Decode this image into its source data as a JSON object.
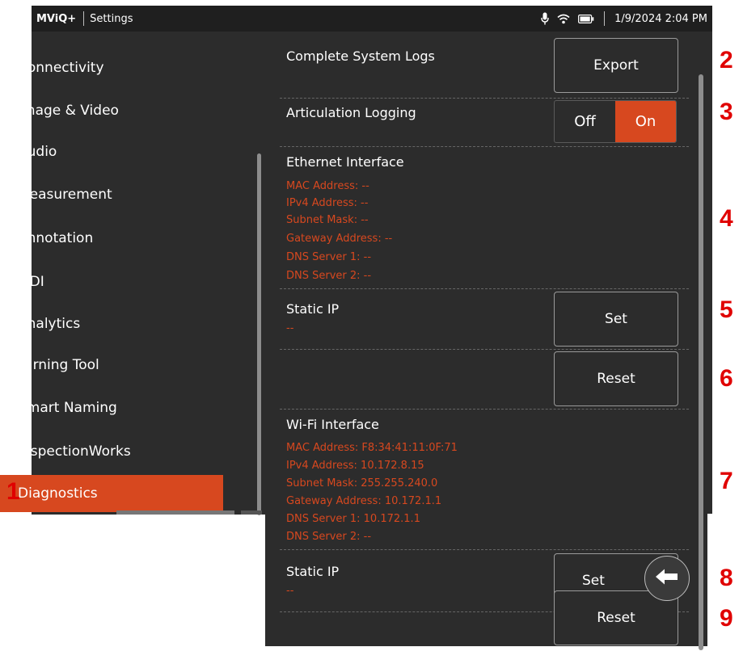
{
  "status_bar": {
    "app_name": "MViQ+",
    "screen_title": "Settings",
    "datetime": "1/9/2024 2:04 PM",
    "icons": [
      "microphone-icon",
      "wifi-icon",
      "battery-icon"
    ]
  },
  "sidebar": {
    "items": [
      {
        "label": "Connectivity"
      },
      {
        "label": "Image & Video"
      },
      {
        "label": "Audio"
      },
      {
        "label": "Measurement"
      },
      {
        "label": "Annotation"
      },
      {
        "label": "MDI"
      },
      {
        "label": "Analytics"
      },
      {
        "label": "Turning Tool"
      },
      {
        "label": "Smart Naming"
      },
      {
        "label": "InspectionWorks"
      },
      {
        "label": "Diagnostics",
        "active": true
      }
    ]
  },
  "diagnostics": {
    "system_logs": {
      "title": "Complete System Logs",
      "button": "Export"
    },
    "articulation_logging": {
      "title": "Articulation Logging",
      "off_label": "Off",
      "on_label": "On",
      "selected": "On"
    },
    "ethernet": {
      "title": "Ethernet Interface",
      "mac": "MAC Address: --",
      "ipv4": "IPv4 Address: --",
      "subnet": "Subnet Mask: --",
      "gateway": "Gateway Address: --",
      "dns1": "DNS Server 1: --",
      "dns2": "DNS Server 2: --"
    },
    "ethernet_static_ip": {
      "title": "Static IP",
      "value": "--",
      "set_button": "Set",
      "reset_button": "Reset"
    },
    "wifi": {
      "title": "Wi-Fi Interface",
      "mac": "MAC Address: F8:34:41:11:0F:71",
      "ipv4": "IPv4 Address: 10.172.8.15",
      "subnet": "Subnet Mask: 255.255.240.0",
      "gateway": "Gateway Address: 10.172.1.1",
      "dns1": "DNS Server 1: 10.172.1.1",
      "dns2": "DNS Server 2: --"
    },
    "wifi_static_ip": {
      "title": "Static IP",
      "value": "--",
      "set_button": "Set",
      "reset_button": "Reset"
    }
  },
  "callouts": [
    "1",
    "2",
    "3",
    "4",
    "5",
    "6",
    "7",
    "8",
    "9"
  ],
  "colors": {
    "accent": "#d7481f",
    "panel": "#2c2c2c",
    "callout": "#e00000"
  }
}
